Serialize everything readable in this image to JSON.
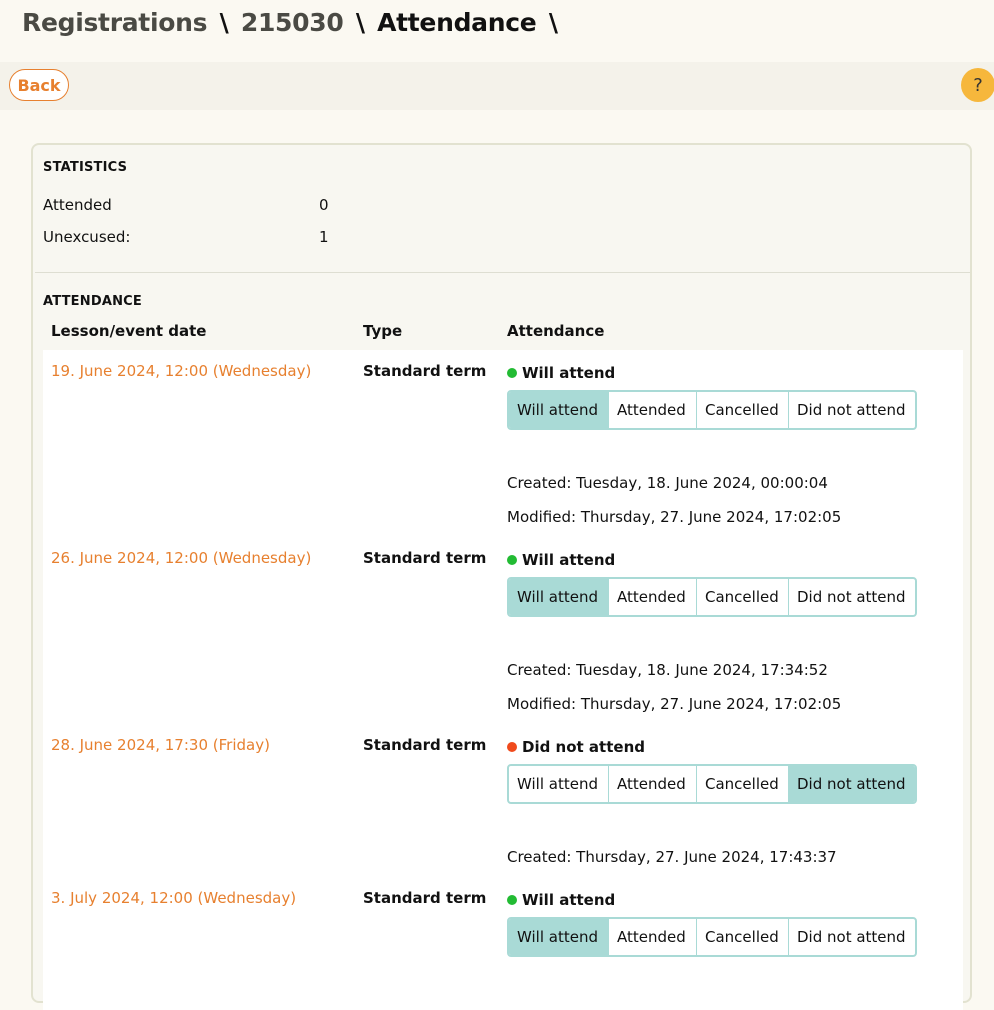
{
  "breadcrumb": {
    "part1": "Registrations",
    "sep": "\\",
    "part2": "215030",
    "current": "Attendance"
  },
  "toolbar": {
    "back_label": "Back",
    "help_label": "?"
  },
  "statistics": {
    "title": "STATISTICS",
    "attended_label": "Attended",
    "attended_value": "0",
    "unexcused_label": "Unexcused:",
    "unexcused_value": "1"
  },
  "attendance": {
    "title": "ATTENDANCE",
    "columns": [
      "Lesson/event date",
      "Type",
      "Attendance"
    ],
    "options": [
      "Will attend",
      "Attended",
      "Cancelled",
      "Did not attend"
    ],
    "rows": [
      {
        "date": "19. June 2024, 12:00 (Wednesday)",
        "type": "Standard term",
        "status": "Will attend",
        "status_color": "#22bb33",
        "selected": 0,
        "created": "Created: Tuesday, 18. June 2024, 00:00:04",
        "modified": "Modified: Thursday, 27. June 2024, 17:02:05"
      },
      {
        "date": "26. June 2024, 12:00 (Wednesday)",
        "type": "Standard term",
        "status": "Will attend",
        "status_color": "#22bb33",
        "selected": 0,
        "created": "Created: Tuesday, 18. June 2024, 17:34:52",
        "modified": "Modified: Thursday, 27. June 2024, 17:02:05"
      },
      {
        "date": "28. June 2024, 17:30 (Friday)",
        "type": "Standard term",
        "status": "Did not attend",
        "status_color": "#f04a1c",
        "selected": 3,
        "created": "Created: Thursday, 27. June 2024, 17:43:37",
        "modified": ""
      },
      {
        "date": "3. July 2024, 12:00 (Wednesday)",
        "type": "Standard term",
        "status": "Will attend",
        "status_color": "#22bb33",
        "selected": 0,
        "created": "",
        "modified": ""
      }
    ]
  },
  "colors": {
    "accent": "#e7802f",
    "selected_segment": "#a9dad6",
    "help_button": "#f6b73c"
  }
}
